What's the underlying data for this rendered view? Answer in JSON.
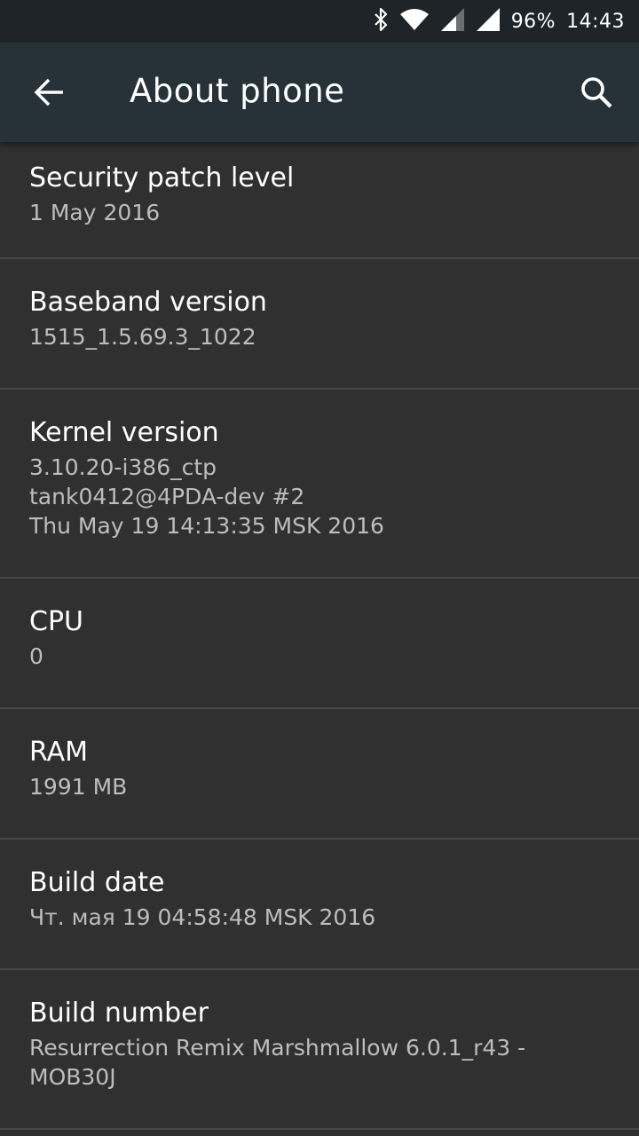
{
  "status_bar": {
    "battery": "96%",
    "time": "14:43",
    "icons": [
      "bluetooth-icon",
      "wifi-icon",
      "signal-icon",
      "signal-icon"
    ]
  },
  "app_bar": {
    "title": "About phone",
    "back_icon": "arrow-back-icon",
    "search_icon": "search-icon"
  },
  "items": [
    {
      "title": "Security patch level",
      "summary": "1 May 2016"
    },
    {
      "title": "Baseband version",
      "summary": "1515_1.5.69.3_1022"
    },
    {
      "title": "Kernel version",
      "summary": "3.10.20-i386_ctp\ntank0412@4PDA-dev #2\nThu May 19 14:13:35 MSK 2016"
    },
    {
      "title": "CPU",
      "summary": "0"
    },
    {
      "title": "RAM",
      "summary": "1991 MB"
    },
    {
      "title": "Build date",
      "summary": "Чт. мая 19 04:58:48 MSK 2016"
    },
    {
      "title": "Build number",
      "summary": "Resurrection Remix Marshmallow 6.0.1_r43 -\nMOB30J"
    }
  ],
  "colors": {
    "status_bar_bg": "#1f2428",
    "app_bar_bg": "#263238",
    "list_bg": "#303030",
    "divider": "#474747",
    "summary_text": "#bdbdbd"
  }
}
